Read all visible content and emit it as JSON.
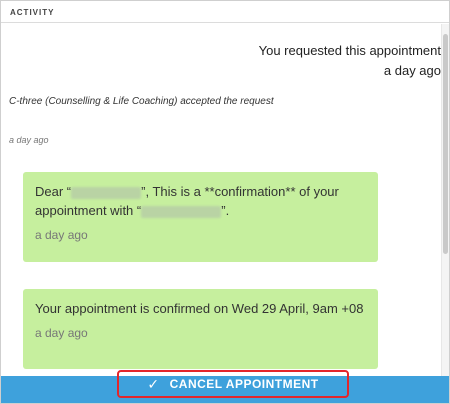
{
  "section": {
    "title": "ACTIVITY"
  },
  "activity": {
    "request": {
      "line1": "You requested this appointment",
      "line2": "a day ago"
    },
    "accepted": {
      "text": "C-three (Counselling & Life Coaching) accepted the request",
      "time": "a day ago"
    },
    "messages": [
      {
        "prefix": "Dear “",
        "mid": "”, This is a **confirmation** of your appointment with “",
        "suffix": "”.",
        "time": "a day ago"
      },
      {
        "text": "Your appointment is confirmed on Wed 29 April, 9am +08",
        "time": "a day ago"
      }
    ]
  },
  "footer": {
    "cancel_label": "CANCEL APPOINTMENT",
    "check_icon": "check-icon",
    "accent": "#3ea1dc",
    "highlight": "#e3262b"
  }
}
